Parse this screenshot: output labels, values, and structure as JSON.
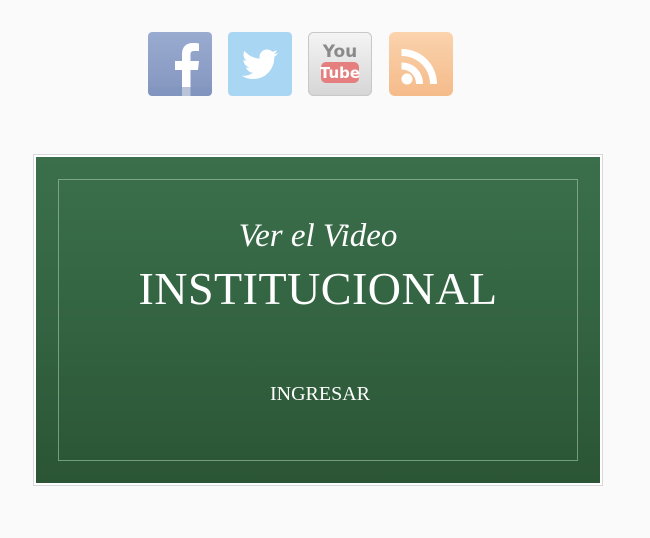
{
  "social": {
    "items": [
      {
        "name": "facebook",
        "icon": "facebook-icon",
        "color": "#8fa3c8"
      },
      {
        "name": "twitter",
        "icon": "twitter-icon",
        "color": "#a9d6f2"
      },
      {
        "name": "youtube",
        "icon": "youtube-icon",
        "color": "#e0e0e0",
        "text_top": "You",
        "text_bottom": "Tube"
      },
      {
        "name": "rss",
        "icon": "rss-icon",
        "color": "#f7c69a"
      }
    ]
  },
  "video": {
    "kicker": "Ver el Video",
    "title": "INSTITUCIONAL",
    "button_label": "INGRESAR",
    "background_color": "#346543",
    "border_color": "#ffffff"
  }
}
